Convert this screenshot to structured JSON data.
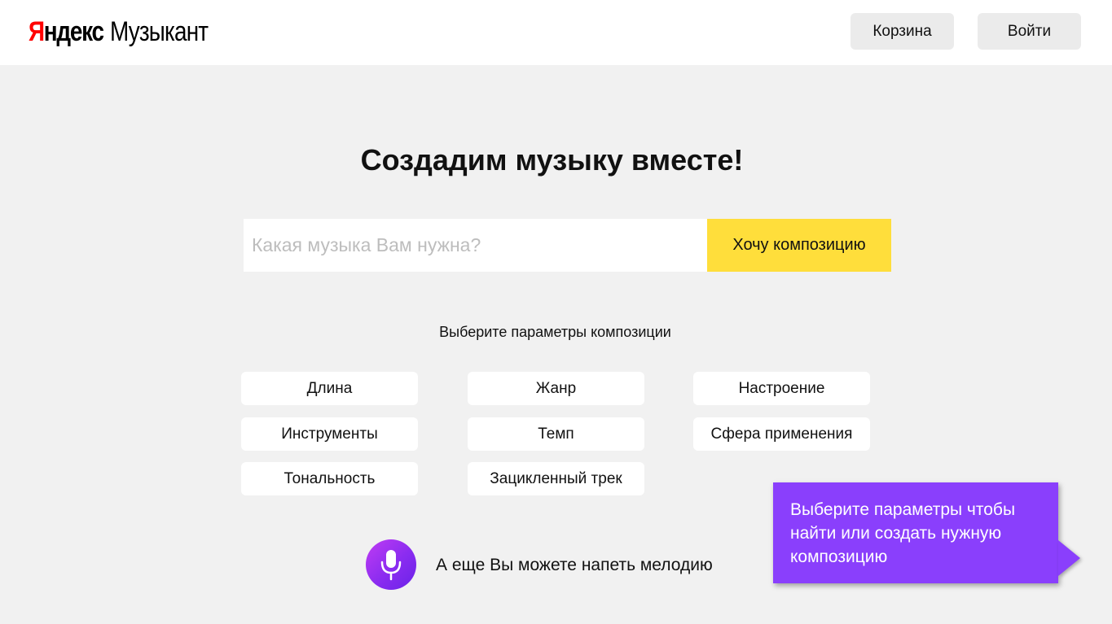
{
  "header": {
    "logo_brand_first": "Я",
    "logo_brand_rest": "ндекс",
    "logo_product": "Музыкант",
    "cart_label": "Корзина",
    "login_label": "Войти"
  },
  "main": {
    "title": "Создадим музыку вместе!",
    "search": {
      "placeholder": "Какая музыка Вам нужна?",
      "value": "",
      "button_label": "Хочу композицию"
    },
    "params_heading": "Выберите параметры композиции",
    "params": [
      "Длина",
      "Жанр",
      "Настроение",
      "Инструменты",
      "Темп",
      "Сфера применения",
      "Тональность",
      "Зацикленный трек"
    ],
    "mic": {
      "icon": "microphone-icon",
      "label": "А еще Вы можете напеть мелодию"
    }
  },
  "tooltip": {
    "text": "Выберите параметры чтобы найти или создать нужную композицию"
  },
  "colors": {
    "accent_yellow": "#ffde3b",
    "accent_purple": "#8a3ffc",
    "logo_red": "#ff0000",
    "page_background": "#f1f1f1"
  }
}
